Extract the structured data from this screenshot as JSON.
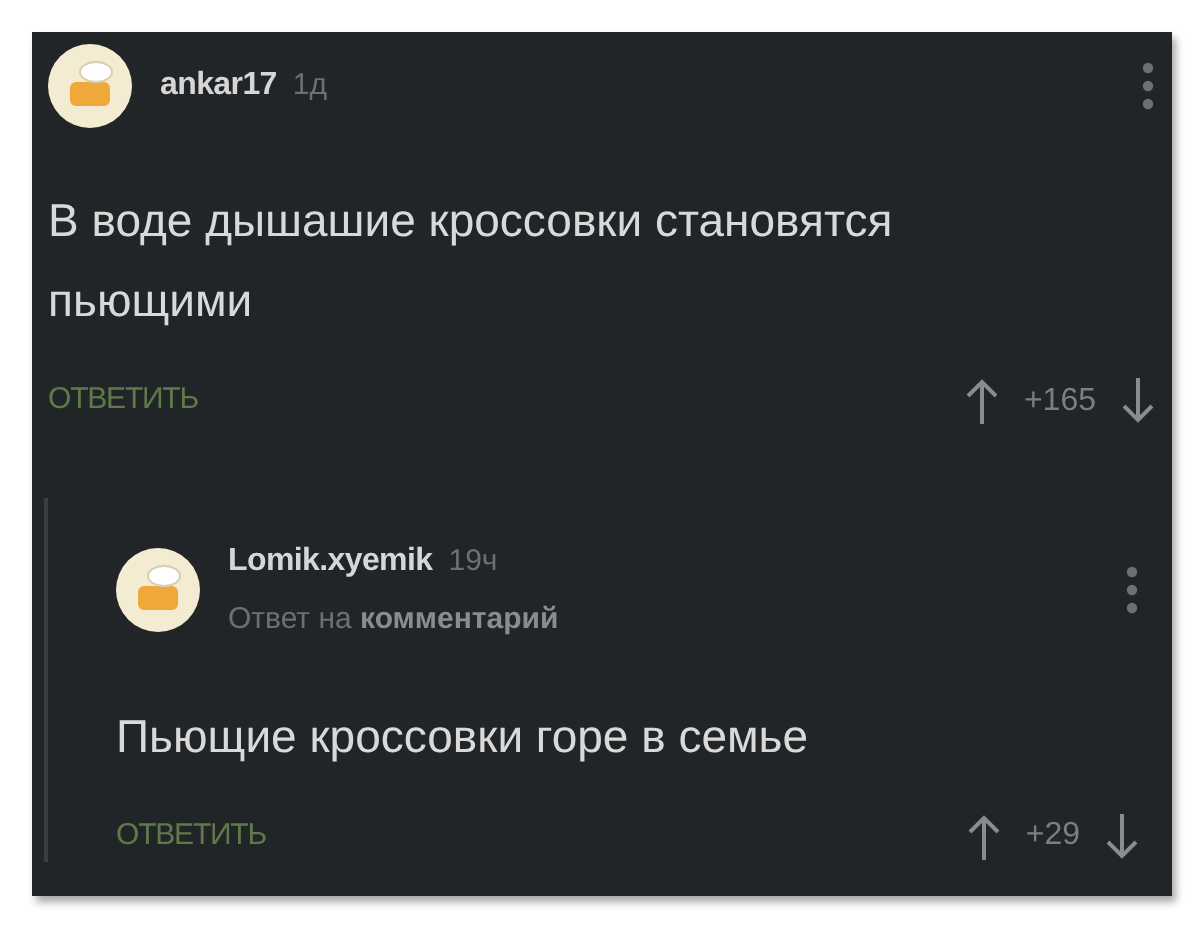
{
  "comments": [
    {
      "author": "ankar17",
      "time": "1д",
      "text": "В воде дышашие кроссовки становятся пьющими",
      "reply_label": "ОТВЕТИТЬ",
      "score": "+165",
      "children": [
        {
          "author": "Lomik.xyemik",
          "time": "19ч",
          "reply_to": {
            "prefix": "Ответ на",
            "target": "комментарий"
          },
          "text": "Пьющие кроссовки горе в семье",
          "reply_label": "ОТВЕТИТЬ",
          "score": "+29"
        }
      ]
    }
  ]
}
